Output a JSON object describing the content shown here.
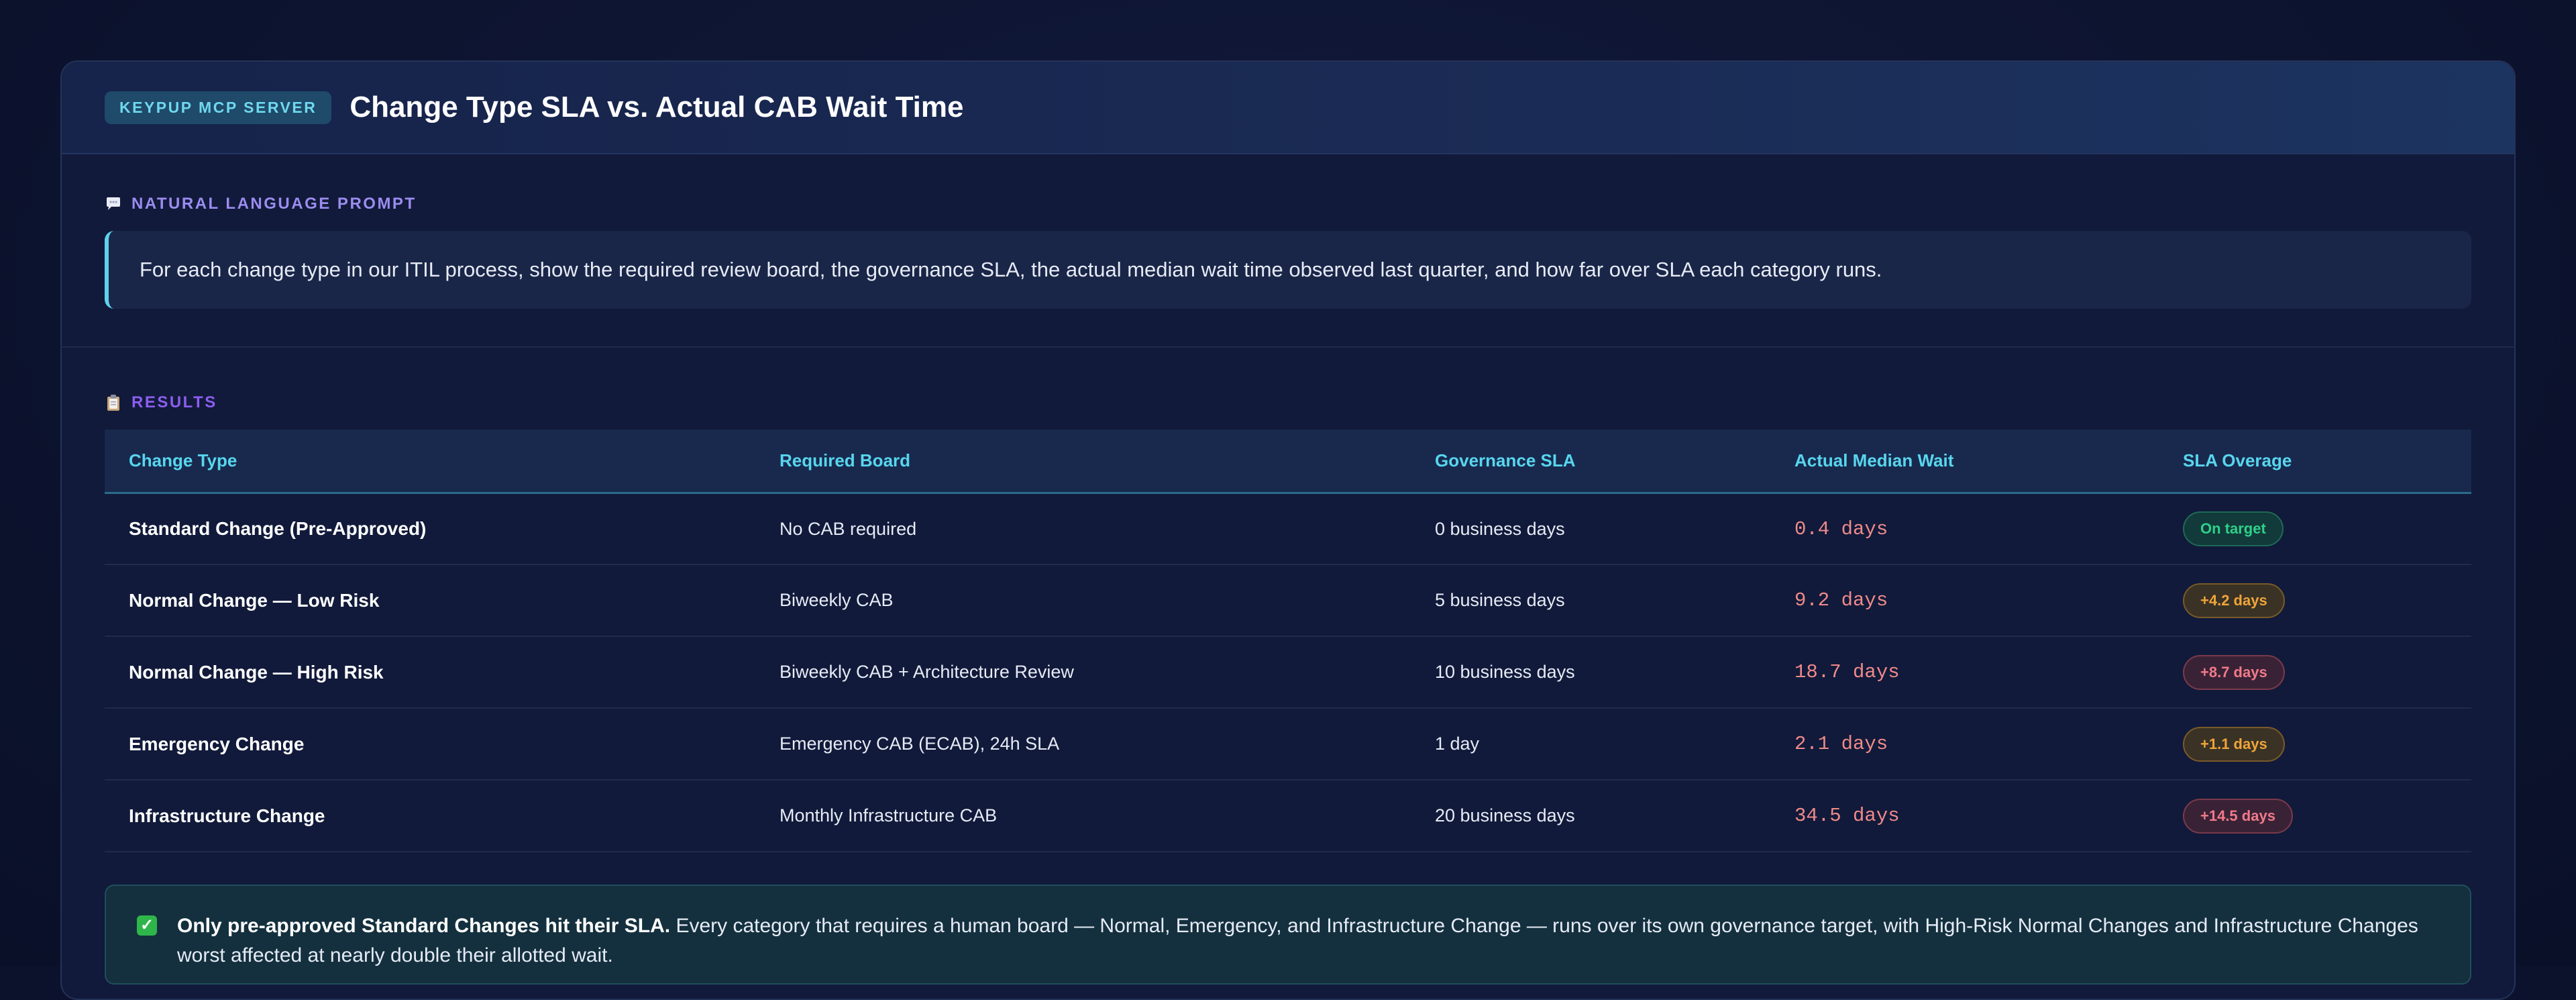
{
  "header": {
    "badge": "KEYPUP MCP SERVER",
    "title": "Change Type SLA vs. Actual CAB Wait Time"
  },
  "prompt": {
    "label": "NATURAL LANGUAGE PROMPT",
    "icon": "speech-bubble-icon",
    "text": "For each change type in our ITIL process, show the required review board, the governance SLA, the actual median wait time observed last quarter, and how far over SLA each category runs."
  },
  "results": {
    "label": "RESULTS",
    "icon": "clipboard-icon",
    "columns": [
      "Change Type",
      "Required Board",
      "Governance SLA",
      "Actual Median Wait",
      "SLA Overage"
    ],
    "rows": [
      {
        "type": "Standard Change (Pre-Approved)",
        "board": "No CAB required",
        "sla": "0 business days",
        "wait": "0.4 days",
        "overage": "On target",
        "status": "green"
      },
      {
        "type": "Normal Change — Low Risk",
        "board": "Biweekly CAB",
        "sla": "5 business days",
        "wait": "9.2 days",
        "overage": "+4.2 days",
        "status": "amber"
      },
      {
        "type": "Normal Change — High Risk",
        "board": "Biweekly CAB + Architecture Review",
        "sla": "10 business days",
        "wait": "18.7 days",
        "overage": "+8.7 days",
        "status": "red"
      },
      {
        "type": "Emergency Change",
        "board": "Emergency CAB (ECAB), 24h SLA",
        "sla": "1 day",
        "wait": "2.1 days",
        "overage": "+1.1 days",
        "status": "amber"
      },
      {
        "type": "Infrastructure Change",
        "board": "Monthly Infrastructure CAB",
        "sla": "20 business days",
        "wait": "34.5 days",
        "overage": "+14.5 days",
        "status": "red"
      }
    ]
  },
  "summary": {
    "icon": "check-icon",
    "bold": "Only pre-approved Standard Changes hit their SLA.",
    "text": " Every category that requires a human board — Normal, Emergency, and Infrastructure Change — runs over its own governance target, with High-Risk Normal Changes and Infrastructure Changes worst affected at nearly double their allotted wait."
  },
  "colors": {
    "accent": "#58d6ee",
    "on_target": "#2fd08a",
    "warning": "#f0a43a",
    "danger": "#f07a8a"
  }
}
